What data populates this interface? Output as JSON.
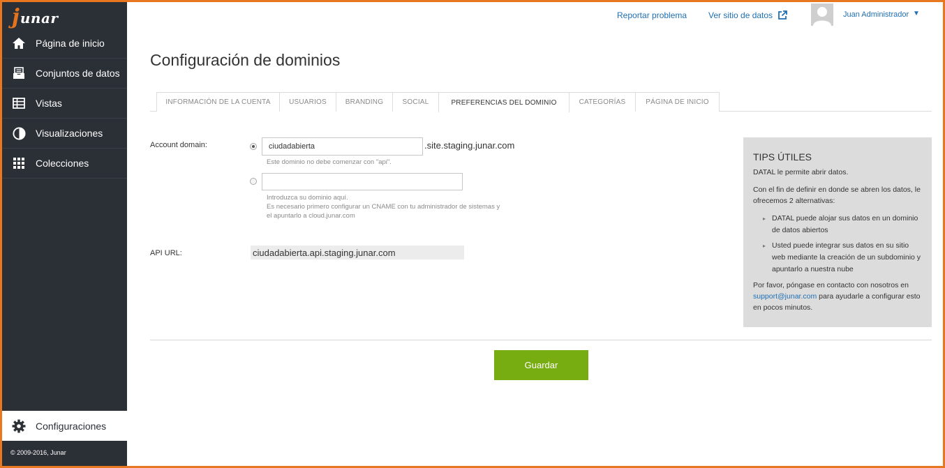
{
  "brand": {
    "logo_letter": "j",
    "logo_text": "unar"
  },
  "sidebar": {
    "items": [
      {
        "label": "Página de inicio",
        "icon": "home-icon"
      },
      {
        "label": "Conjuntos de datos",
        "icon": "inbox-icon"
      },
      {
        "label": "Vistas",
        "icon": "table-icon"
      },
      {
        "label": "Visualizaciones",
        "icon": "pie-chart-icon"
      },
      {
        "label": "Colecciones",
        "icon": "grid-icon"
      }
    ],
    "config_label": "Configuraciones",
    "copyright": "© 2009-2016, Junar"
  },
  "topbar": {
    "report_link": "Reportar problema",
    "site_link": "Ver sitio de datos",
    "user_name": "Juan Administrador",
    "caret": "▼"
  },
  "page": {
    "title": "Configuración de dominios"
  },
  "tabs": [
    {
      "label": "INFORMACIÓN DE LA CUENTA",
      "active": false
    },
    {
      "label": "USUARIOS",
      "active": false
    },
    {
      "label": "BRANDING",
      "active": false
    },
    {
      "label": "SOCIAL",
      "active": false
    },
    {
      "label": "PREFERENCIAS DEL DOMINIO",
      "active": true
    },
    {
      "label": "CATEGORÍAS",
      "active": false
    },
    {
      "label": "PÁGINA DE INICIO",
      "active": false
    }
  ],
  "form": {
    "account_domain_label": "Account domain:",
    "subdomain_value": "ciudadabierta",
    "subdomain_suffix": ".site.staging.junar.com",
    "subdomain_hint": "Este dominio no debe comenzar con \"api\".",
    "custom_domain_value": "",
    "custom_hint_1": "Introduzca su dominio aquí.",
    "custom_hint_2": "Es necesario primero configurar un CNAME con tu administrador de sistemas y",
    "custom_hint_3": "el apuntarlo a cloud.junar.com",
    "api_url_label": "API URL:",
    "api_url_value": "ciudadabierta.api.staging.junar.com",
    "selected_option": "subdomain"
  },
  "tips": {
    "title": "TIPS ÚTILES",
    "intro": "DATAL le permite abrir datos.",
    "lead": "Con el fin de definir en donde se abren los datos, le ofrecemos 2 alternativas:",
    "bullets": [
      "DATAL puede alojar sus datos en un dominio de datos abiertos",
      "Usted puede integrar sus datos en su sitio web mediante la creación de un subdominio y apuntarlo a nuestra nube"
    ],
    "contact_before": "Por favor, póngase en contacto con nosotros en",
    "contact_email": "support@junar.com",
    "contact_after": "para ayudarle a configurar esto en pocos minutos."
  },
  "actions": {
    "save_label": "Guardar"
  },
  "colors": {
    "sidebar_bg": "#2b2f36",
    "accent_orange": "#e87722",
    "link_blue": "#1f6fb3",
    "save_green": "#78ad11",
    "tips_bg": "#dcdcdc"
  }
}
